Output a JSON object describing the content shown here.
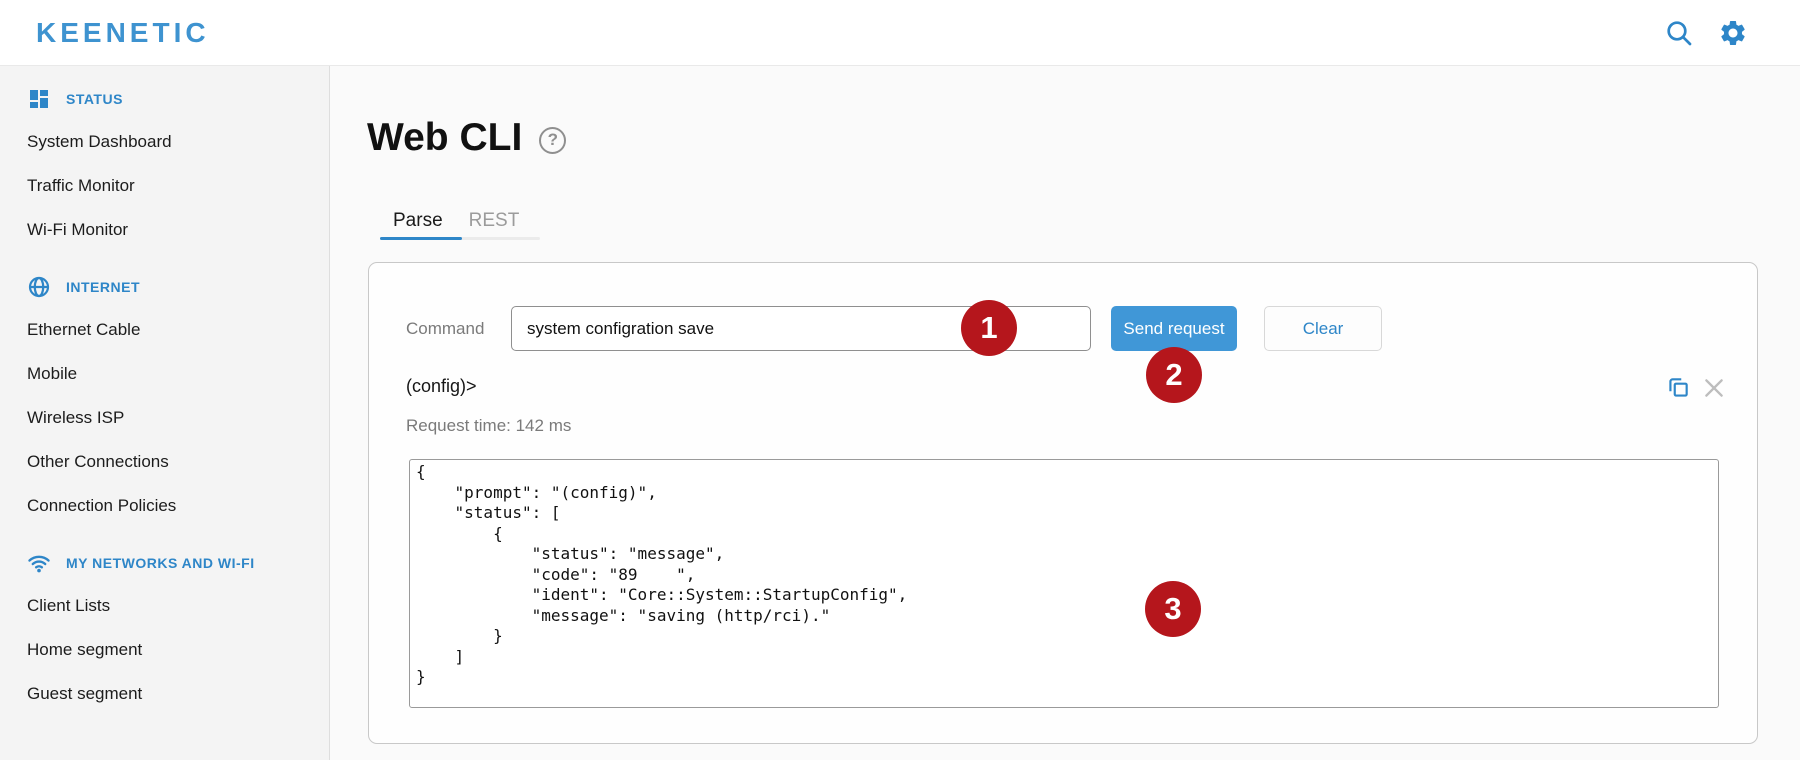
{
  "header": {
    "logo_text": "KEENETIC"
  },
  "sidebar": {
    "sections": [
      {
        "label": "STATUS",
        "icon": "dashboard-icon",
        "items": [
          "System Dashboard",
          "Traffic Monitor",
          "Wi-Fi Monitor"
        ]
      },
      {
        "label": "INTERNET",
        "icon": "globe-icon",
        "items": [
          "Ethernet Cable",
          "Mobile",
          "Wireless ISP",
          "Other Connections",
          "Connection Policies"
        ]
      },
      {
        "label": "MY NETWORKS AND WI-FI",
        "icon": "wifi-icon",
        "items": [
          "Client Lists",
          "Home segment",
          "Guest segment"
        ]
      }
    ]
  },
  "main": {
    "title": "Web CLI",
    "tabs": [
      {
        "label": "Parse",
        "active": true
      },
      {
        "label": "REST",
        "active": false
      }
    ],
    "command": {
      "label": "Command",
      "value": "system configration save"
    },
    "buttons": {
      "send": "Send request",
      "clear": "Clear"
    },
    "prompt": "(config)>",
    "request_time": "Request time: 142 ms",
    "output": "{\n    \"prompt\": \"(config)\",\n    \"status\": [\n        {\n            \"status\": \"message\",\n            \"code\": \"89    \",\n            \"ident\": \"Core::System::StartupConfig\",\n            \"message\": \"saving (http/rci).\"\n        }\n    ]\n}",
    "badges": [
      "1",
      "2",
      "3"
    ]
  },
  "colors": {
    "accent_blue": "#2e86c8",
    "logo_blue": "#3e93d0",
    "send_button_blue": "#4097d7",
    "badge_red": "#b5161c"
  }
}
